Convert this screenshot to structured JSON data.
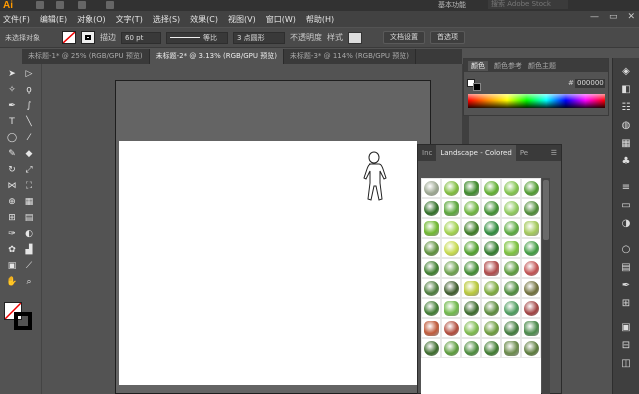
{
  "app": {
    "logo": "Ai",
    "workspace": "基本功能",
    "search_placeholder": "搜索 Adobe Stock"
  },
  "menu": [
    "文件(F)",
    "编辑(E)",
    "对象(O)",
    "文字(T)",
    "选择(S)",
    "效果(C)",
    "视图(V)",
    "窗口(W)",
    "帮助(H)"
  ],
  "control": {
    "selection_state": "未选择对象",
    "stroke_label": "描边",
    "stroke_value": "60 pt",
    "uniform_label": "等比",
    "brush_value": "3 点圆形",
    "opacity_label": "不透明度",
    "style_label": "样式",
    "doc_setup": "文档设置",
    "preferences": "首选项"
  },
  "tabs": [
    {
      "label": "未标题-1* @ 25% (RGB/GPU 预览)",
      "active": false
    },
    {
      "label": "未标题-2* @ 3.13% (RGB/GPU 预览)",
      "active": true
    },
    {
      "label": "未标题-3* @ 114% (RGB/GPU 预览)",
      "active": false
    }
  ],
  "color_panel": {
    "tabs": [
      "颜色",
      "颜色参考",
      "颜色主题"
    ],
    "hex": "000000"
  },
  "symbols_panel": {
    "tabs": [
      "Inc",
      "Landscape - Colored",
      "Pe"
    ]
  },
  "colors": {
    "accent": "#ff9a00",
    "canvas": "#ffffff",
    "bg": "#535353"
  },
  "plants": [
    "#9aa58f",
    "#7dbb3a",
    "#3d8a2a",
    "#5fae2f",
    "#7fc24a",
    "#4e9a2e",
    "#2f6e25",
    "#5aa63a",
    "#6bb33c",
    "#3f8f30",
    "#8cc85a",
    "#4c8a34",
    "#6fb82f",
    "#9fd04a",
    "#3b7a22",
    "#2d8a3a",
    "#58a83c",
    "#a3c95a",
    "#5c8f3a",
    "#c4d94a",
    "#4f9f2a",
    "#2f7a2a",
    "#7bc23c",
    "#3e9a3e",
    "#3c7c2c",
    "#6a9f4a",
    "#3f8a2f",
    "#b04a4a",
    "#5a9a3a",
    "#c05050",
    "#4a7a3a",
    "#3c5a2a",
    "#b9c93a",
    "#7aa83a",
    "#4c8a3a",
    "#6f6f3a",
    "#3e7a30",
    "#6fb84a",
    "#3a6a2a",
    "#5a8a3a",
    "#4a9a5a",
    "#a04040",
    "#c05a3a",
    "#b04a3a",
    "#7ab84a",
    "#6a9a3a",
    "#3f7a3a",
    "#4a8a4a",
    "#3a6a2a",
    "#5a9a3a",
    "#4a8a3a",
    "#3e7a2e",
    "#6a8a4a",
    "#5a7a3a"
  ]
}
